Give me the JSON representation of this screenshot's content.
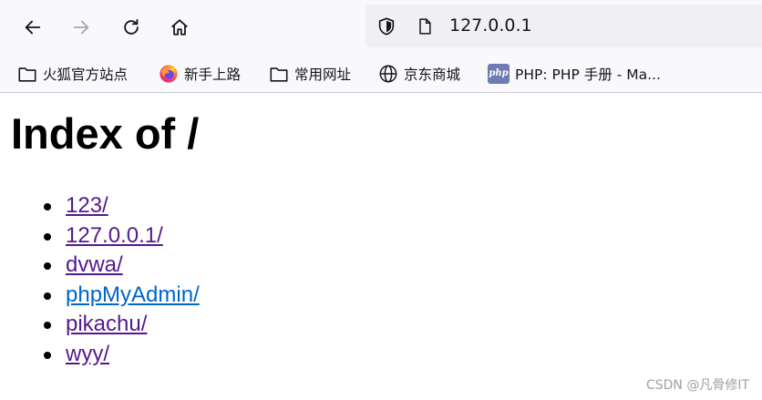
{
  "browser": {
    "url": "127.0.0.1",
    "icons": {
      "back": "arrow-left",
      "forward": "arrow-right",
      "reload": "reload",
      "home": "home",
      "tracking_protection": "shield",
      "page_info": "page"
    },
    "bookmarks": [
      {
        "label": "火狐官方站点",
        "icon": "folder"
      },
      {
        "label": "新手上路",
        "icon": "firefox-logo"
      },
      {
        "label": "常用网址",
        "icon": "folder"
      },
      {
        "label": "京东商城",
        "icon": "globe"
      },
      {
        "label": "PHP: PHP 手册 - Ma...",
        "icon": "php-badge",
        "badge_text": "php"
      }
    ]
  },
  "page": {
    "title": "Index of /",
    "entries": [
      {
        "label": "123/",
        "visited": true
      },
      {
        "label": "127.0.0.1/",
        "visited": true
      },
      {
        "label": "dvwa/",
        "visited": true
      },
      {
        "label": "phpMyAdmin/",
        "visited": false
      },
      {
        "label": "pikachu/",
        "visited": true
      },
      {
        "label": "wyy/",
        "visited": true
      }
    ]
  },
  "watermark": "CSDN @凡骨修IT",
  "colors": {
    "link_visited": "#551a8b",
    "link_unvisited": "#0066cc",
    "toolbar_bg": "#f9f9fb",
    "urlbar_bg": "#f0f0f4"
  }
}
